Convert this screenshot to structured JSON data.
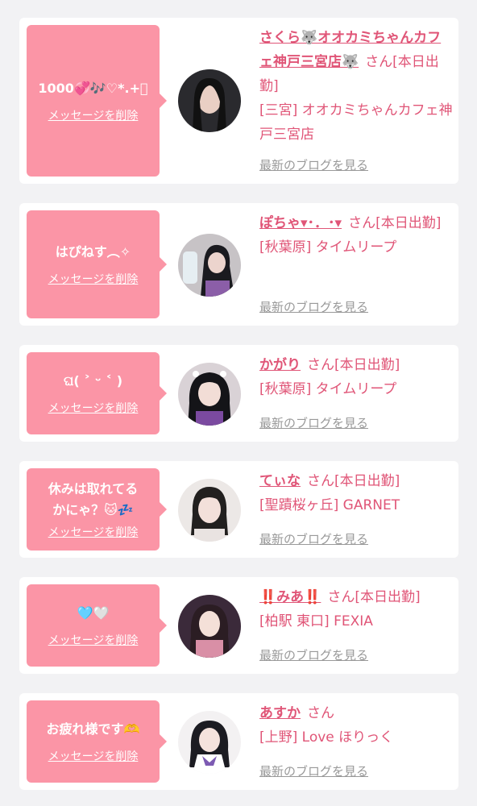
{
  "colors": {
    "background": "#f2f2f4",
    "bubble": "#fb95a6",
    "accent_text": "#e05577",
    "muted_link": "#999999"
  },
  "delete_label": "メッセージを削除",
  "blog_label": "最新のブログを見る",
  "messages": [
    {
      "bubble_text": "1000💞🎶♡*.+ﾟ",
      "name": "さくら🐺オオカミちゃんカフェ神戸三宮店🐺",
      "suffix": "さん[本日出勤]",
      "location": "[三宮] オオカミちゃんカフェ神戸三宮店"
    },
    {
      "bubble_text": "はぴねす︵✧",
      "name": "ぽちゃ▾･．･▾",
      "suffix": "さん[本日出勤]",
      "location": "[秋葉原] タイムリープ"
    },
    {
      "bubble_text": "ଘ( ˃ ᵕ ˂ )",
      "name": "かがり",
      "suffix": "さん[本日出勤]",
      "location": "[秋葉原] タイムリープ"
    },
    {
      "bubble_text": "休みは取れてるかにゃ？🐱💤",
      "name": "てぃな",
      "suffix": "さん[本日出勤]",
      "location": "[聖蹟桜ヶ丘] GARNET"
    },
    {
      "bubble_text": "🩵🤍",
      "name": "‼️みあ‼️",
      "suffix": "さん[本日出勤]",
      "location": "[柏駅 東口] FEXIA"
    },
    {
      "bubble_text": "お疲れ様です🫶",
      "name": "あすか",
      "suffix": "さん",
      "location": "[上野] Love ほりっく"
    }
  ]
}
